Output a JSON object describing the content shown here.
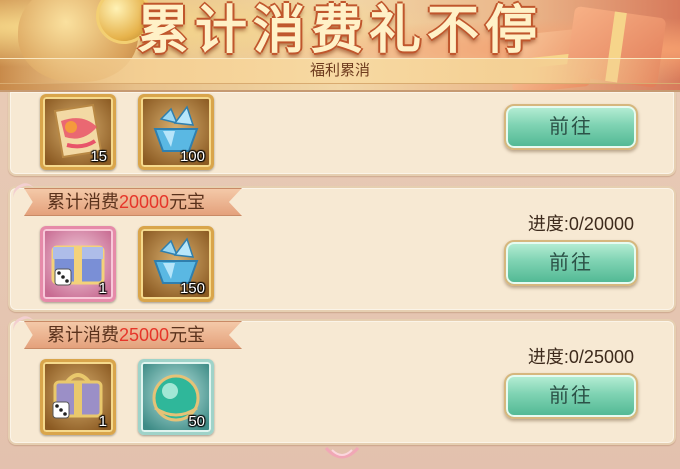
{
  "header": {
    "title": "累计消费礼不停",
    "subtitle": "福利累消"
  },
  "tiers": [
    {
      "items": [
        {
          "icon": "scroll-fan-icon",
          "qty": "15"
        },
        {
          "icon": "blue-crystal-icon",
          "qty": "100"
        }
      ],
      "button": "前往"
    },
    {
      "label_prefix": "累计消费",
      "amount": "20000",
      "label_suffix": "元宝",
      "progress": "进度:0/20000",
      "items": [
        {
          "icon": "treasure-chest-dice-icon",
          "qty": "1"
        },
        {
          "icon": "blue-crystal-icon",
          "qty": "150"
        }
      ],
      "button": "前往"
    },
    {
      "label_prefix": "累计消费",
      "amount": "25000",
      "label_suffix": "元宝",
      "progress": "进度:0/25000",
      "items": [
        {
          "icon": "gift-box-dice-icon",
          "qty": "1"
        },
        {
          "icon": "jade-orb-icon",
          "qty": "50"
        }
      ],
      "button": "前往"
    }
  ],
  "colors": {
    "accent_amount": "#e6362a",
    "button_green": "#7fd3b3",
    "panel_bg": "#f7e9d3"
  }
}
